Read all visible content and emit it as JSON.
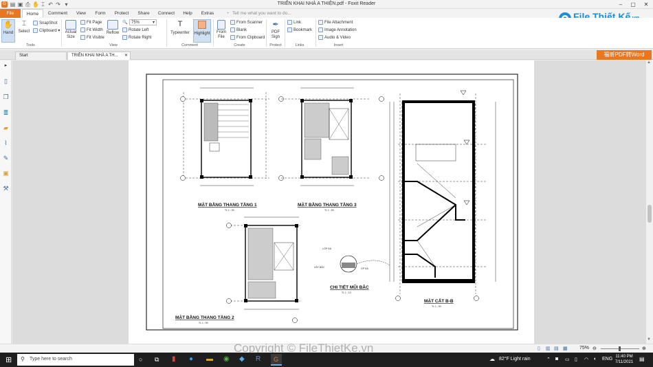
{
  "window": {
    "title": "TRIỂN KHAI NHÀ A THIỆN.pdf - Foxit Reader"
  },
  "menu": {
    "file": "File",
    "home": "Home",
    "items": [
      "Comment",
      "View",
      "Form",
      "Protect",
      "Share",
      "Connect",
      "Help",
      "Extras"
    ],
    "tell_me": "Tell me what you want to do..."
  },
  "ribbon": {
    "tools": {
      "hand": "Hand",
      "select": "Select",
      "snapshot": "SnapShot",
      "clipboard": "Clipboard",
      "group": "Tools"
    },
    "view": {
      "actual_size": "Actual Size",
      "fit_page": "Fit Page",
      "fit_width": "Fit Width",
      "fit_visible": "Fit Visible",
      "reflow": "Reflow",
      "zoom": "75%",
      "rotate_left": "Rotate Left",
      "rotate_right": "Rotate Right",
      "group": "View"
    },
    "comment": {
      "typewriter": "Typewriter",
      "highlight": "Highlight",
      "group": "Comment"
    },
    "create": {
      "from_file": "From File",
      "from_scanner": "From Scanner",
      "blank": "Blank",
      "from_clipboard": "From Clipboard",
      "group": "Create"
    },
    "protect": {
      "pdf_sign": "PDF Sign",
      "group": "Protect"
    },
    "links": {
      "link": "Link",
      "bookmark": "Bookmark",
      "group": "Links"
    },
    "insert": {
      "file_attachment": "File Attachment",
      "image_annotation": "Image Annotation",
      "audio_video": "Audio & Video",
      "group": "Insert"
    }
  },
  "tabs": {
    "start": "Start",
    "doc": "TRIỂN KHAI NHÀ A TH..."
  },
  "convert": "福昕PDF转Word",
  "watermark": {
    "brand": "File Thiết Kế",
    "suffix": ".vn",
    "copyright": "Copyright © FileThietKe.vn"
  },
  "drawing": {
    "plan1": "MẶT BẰNG THANG TẦNG 1",
    "plan2": "MẶT BẰNG THANG TẦNG 2",
    "plan3": "MẶT BẰNG THANG TẦNG 3",
    "detail": "CHI TIẾT MŨI BẬC",
    "section": "MẶT CẮT B-B",
    "scale50": "TL 1 : 50",
    "scale10": "TL 1 : 10"
  },
  "status": {
    "zoom": "75%"
  },
  "taskbar": {
    "search": "Type here to search",
    "weather": "82°F  Light rain",
    "lang": "ENG",
    "time": "11:40 PM",
    "date": "7/11/2021"
  }
}
